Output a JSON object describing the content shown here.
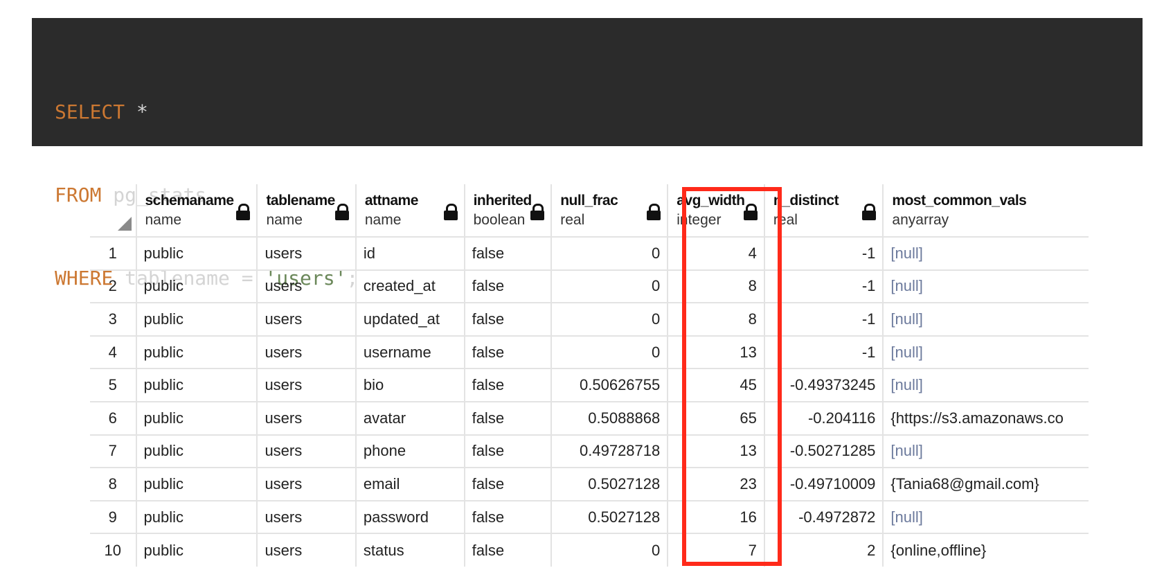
{
  "query": {
    "line1": {
      "kw": "SELECT",
      "rest": " *"
    },
    "line2": {
      "kw": "FROM",
      "rest": " pg_stats"
    },
    "line3": {
      "kw": "WHERE",
      "rest": " tablename = ",
      "str": "'users'",
      "end": ";"
    }
  },
  "columns": [
    {
      "name": "schemaname",
      "type": "name"
    },
    {
      "name": "tablename",
      "type": "name"
    },
    {
      "name": "attname",
      "type": "name"
    },
    {
      "name": "inherited",
      "type": "boolean"
    },
    {
      "name": "null_frac",
      "type": "real"
    },
    {
      "name": "avg_width",
      "type": "integer"
    },
    {
      "name": "n_distinct",
      "type": "real"
    },
    {
      "name": "most_common_vals",
      "type": "anyarray"
    }
  ],
  "rows": [
    [
      "1",
      "public",
      "users",
      "id",
      "false",
      "0",
      "4",
      "-1",
      "[null]"
    ],
    [
      "2",
      "public",
      "users",
      "created_at",
      "false",
      "0",
      "8",
      "-1",
      "[null]"
    ],
    [
      "3",
      "public",
      "users",
      "updated_at",
      "false",
      "0",
      "8",
      "-1",
      "[null]"
    ],
    [
      "4",
      "public",
      "users",
      "username",
      "false",
      "0",
      "13",
      "-1",
      "[null]"
    ],
    [
      "5",
      "public",
      "users",
      "bio",
      "false",
      "0.50626755",
      "45",
      "-0.49373245",
      "[null]"
    ],
    [
      "6",
      "public",
      "users",
      "avatar",
      "false",
      "0.5088868",
      "65",
      "-0.204116",
      "{https://s3.amazonaws.co"
    ],
    [
      "7",
      "public",
      "users",
      "phone",
      "false",
      "0.49728718",
      "13",
      "-0.50271285",
      "[null]"
    ],
    [
      "8",
      "public",
      "users",
      "email",
      "false",
      "0.5027128",
      "23",
      "-0.49710009",
      "{Tania68@gmail.com}"
    ],
    [
      "9",
      "public",
      "users",
      "password",
      "false",
      "0.5027128",
      "16",
      "-0.4972872",
      "[null]"
    ],
    [
      "10",
      "public",
      "users",
      "status",
      "false",
      "0",
      "7",
      "2",
      "{online,offline}"
    ]
  ],
  "highlight_color": "#ff2a1a",
  "null_color": "#6c7a9c"
}
